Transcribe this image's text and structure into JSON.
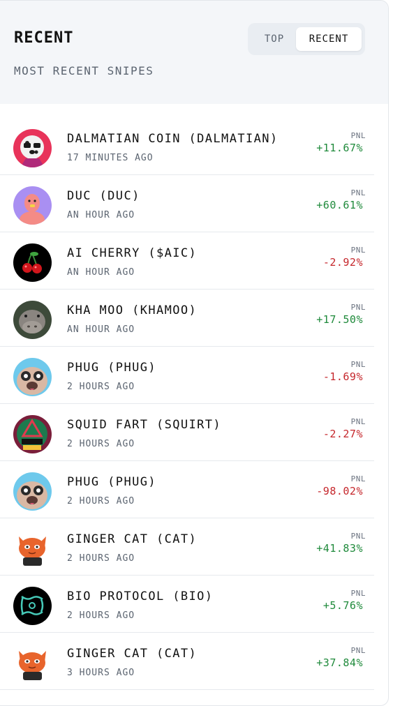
{
  "header": {
    "title": "RECENT",
    "subtitle": "MOST RECENT SNIPES",
    "tabs": [
      {
        "label": "TOP",
        "active": false
      },
      {
        "label": "RECENT",
        "active": true
      }
    ]
  },
  "colors": {
    "positive": "#1f8a3b",
    "negative": "#c5262b",
    "header_bg": "#f4f6f9"
  },
  "snipes": [
    {
      "name": "DALMATIAN COIN (DALMATIAN)",
      "time": "17 MINUTES AGO",
      "pnl_label": "PNL",
      "pnl": "+11.67%",
      "icon": "dalmatian-avatar-icon"
    },
    {
      "name": "DUC (DUC)",
      "time": "AN HOUR AGO",
      "pnl_label": "PNL",
      "pnl": "+60.61%",
      "icon": "duck-avatar-icon"
    },
    {
      "name": "AI CHERRY ($AIC)",
      "time": "AN HOUR AGO",
      "pnl_label": "PNL",
      "pnl": "-2.92%",
      "icon": "cherry-avatar-icon"
    },
    {
      "name": "KHA MOO (KHAMOO)",
      "time": "AN HOUR AGO",
      "pnl_label": "PNL",
      "pnl": "+17.50%",
      "icon": "hippo-avatar-icon"
    },
    {
      "name": "PHUG (PHUG)",
      "time": "2 HOURS AGO",
      "pnl_label": "PNL",
      "pnl": "-1.69%",
      "icon": "pug-avatar-icon"
    },
    {
      "name": "SQUID FART (SQUIRT)",
      "time": "2 HOURS AGO",
      "pnl_label": "PNL",
      "pnl": "-2.27%",
      "icon": "squid-fart-avatar-icon"
    },
    {
      "name": "PHUG (PHUG)",
      "time": "2 HOURS AGO",
      "pnl_label": "PNL",
      "pnl": "-98.02%",
      "icon": "pug-avatar-icon"
    },
    {
      "name": "GINGER CAT (CAT)",
      "time": "2 HOURS AGO",
      "pnl_label": "PNL",
      "pnl": "+41.83%",
      "icon": "ginger-cat-avatar-icon"
    },
    {
      "name": "BIO PROTOCOL (BIO)",
      "time": "2 HOURS AGO",
      "pnl_label": "PNL",
      "pnl": "+5.76%",
      "icon": "bio-protocol-avatar-icon"
    },
    {
      "name": "GINGER CAT (CAT)",
      "time": "3 HOURS AGO",
      "pnl_label": "PNL",
      "pnl": "+37.84%",
      "icon": "ginger-cat-avatar-icon"
    }
  ]
}
